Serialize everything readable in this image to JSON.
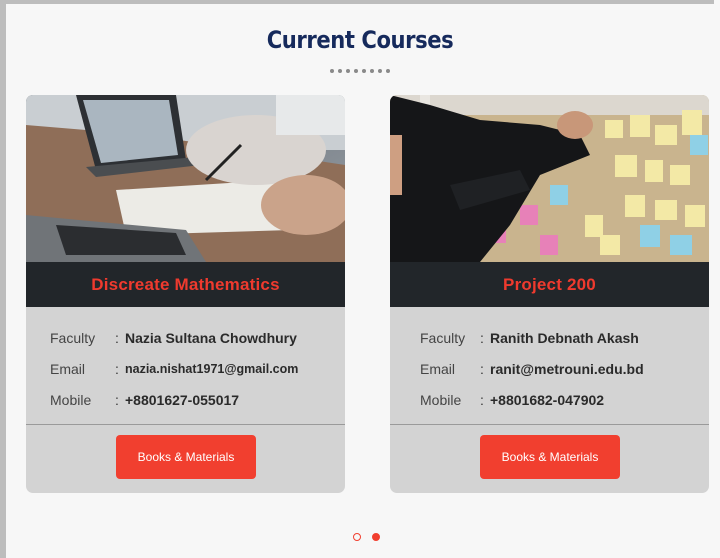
{
  "header": {
    "title": "Current Courses"
  },
  "courses": [
    {
      "name": "Discreate Mathematics",
      "faculty_label": "Faculty",
      "faculty": "Nazia Sultana Chowdhury",
      "email_label": "Email",
      "email": "nazia.nishat1971@gmail.com",
      "mobile_label": "Mobile",
      "mobile": "+8801627-055017",
      "button": "Books & Materials"
    },
    {
      "name": "Project 200",
      "faculty_label": "Faculty",
      "faculty": "Ranith Debnath Akash",
      "email_label": "Email",
      "email": "ranit@metrouni.edu.bd",
      "mobile_label": "Mobile",
      "mobile": "+8801682-047902",
      "button": "Books & Materials"
    }
  ],
  "carousel": {
    "pages": 2,
    "active_page": 2
  },
  "colors": {
    "accent": "#f13f2f",
    "title": "#162a5c",
    "band": "#22262a"
  }
}
